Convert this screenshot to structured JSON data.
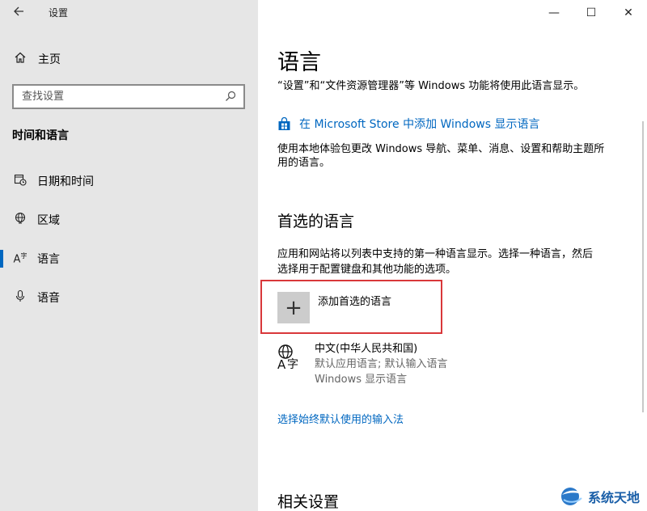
{
  "window": {
    "title": "设置",
    "back_icon": "arrow-left-icon",
    "minimize_glyph": "—",
    "maximize_glyph": "☐",
    "close_glyph": "✕"
  },
  "sidebar": {
    "home_label": "主页",
    "search_placeholder": "查找设置",
    "section_title": "时间和语言",
    "items": [
      {
        "label": "日期和时间",
        "icon": "calendar-clock-icon"
      },
      {
        "label": "区域",
        "icon": "globe-icon"
      },
      {
        "label": "语言",
        "icon": "language-icon",
        "selected": true
      },
      {
        "label": "语音",
        "icon": "microphone-icon"
      }
    ]
  },
  "main": {
    "title": "语言",
    "intro": "“设置”和“文件资源管理器”等 Windows 功能将使用此语言显示。",
    "store_link": "在 Microsoft Store 中添加 Windows 显示语言",
    "store_desc_line1": "使用本地体验包更改 Windows 导航、菜单、消息、设置和帮助主题所",
    "store_desc_line2": "用的语言。",
    "preferred_title": "首选的语言",
    "preferred_desc_line1": "应用和网站将以列表中支持的第一种语言显示。选择一种语言，然后",
    "preferred_desc_line2": "选择用于配置键盘和其他功能的选项。",
    "add_language_label": "添加首选的语言",
    "add_glyph": "+",
    "language": {
      "name": "中文(中华人民共和国)",
      "detail1": "默认应用语言; 默认输入语言",
      "detail2": "Windows 显示语言"
    },
    "input_link": "选择始终默认使用的输入法",
    "related_title": "相关设置"
  },
  "watermark": {
    "text": "系统天地"
  },
  "colors": {
    "accent": "#0067c0",
    "highlight_box": "#d9373a",
    "sidebar_bg": "#e6e6e6"
  }
}
